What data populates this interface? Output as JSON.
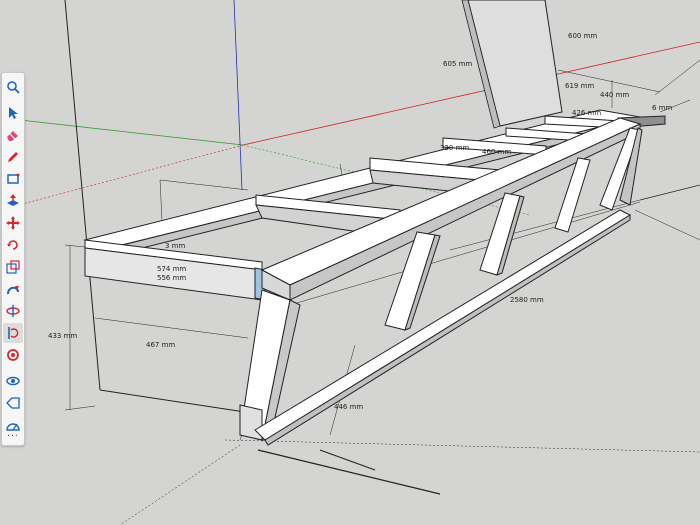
{
  "toolbar": {
    "tools": [
      {
        "name": "search",
        "icon": "search-icon"
      },
      {
        "name": "select",
        "icon": "select-arrow-icon"
      },
      {
        "name": "eraser",
        "icon": "eraser-icon"
      },
      {
        "name": "pencil",
        "icon": "pencil-icon"
      },
      {
        "name": "rectangle",
        "icon": "rectangle-icon"
      },
      {
        "name": "push-pull",
        "icon": "push-pull-icon"
      },
      {
        "name": "move",
        "icon": "move-icon"
      },
      {
        "name": "rotate",
        "icon": "rotate-icon"
      },
      {
        "name": "scale",
        "icon": "scale-icon"
      },
      {
        "name": "follow-me",
        "icon": "follow-me-icon"
      },
      {
        "name": "flip",
        "icon": "flip-icon"
      },
      {
        "name": "tape-measure",
        "icon": "tape-measure-icon"
      },
      {
        "name": "paint-bucket",
        "icon": "paint-bucket-icon"
      },
      {
        "name": "orbit",
        "icon": "orbit-icon"
      },
      {
        "name": "tag",
        "icon": "tag-icon"
      },
      {
        "name": "protractor",
        "icon": "protractor-icon"
      }
    ],
    "more": "..."
  },
  "colors": {
    "background": "#d4d4d2",
    "wood_face": "#ffffff",
    "wood_shade": "#c8c8c8",
    "selected_face": "#9ec4df",
    "axis_red": "#cc2222",
    "axis_green": "#2a9a2a",
    "axis_blue": "#2233bb"
  },
  "dimensions": {
    "d600": "600 mm",
    "d605": "605 mm",
    "d619": "619 mm",
    "d440": "440 mm",
    "d426": "426 mm",
    "d6": "6 mm",
    "d460": "460 mm",
    "d320": "320 mm",
    "d574": "574 mm",
    "d556": "556 mm",
    "d433": "433 mm",
    "d467": "467 mm",
    "d446": "446 mm",
    "d2580": "2580 mm",
    "d3": "3 mm"
  }
}
